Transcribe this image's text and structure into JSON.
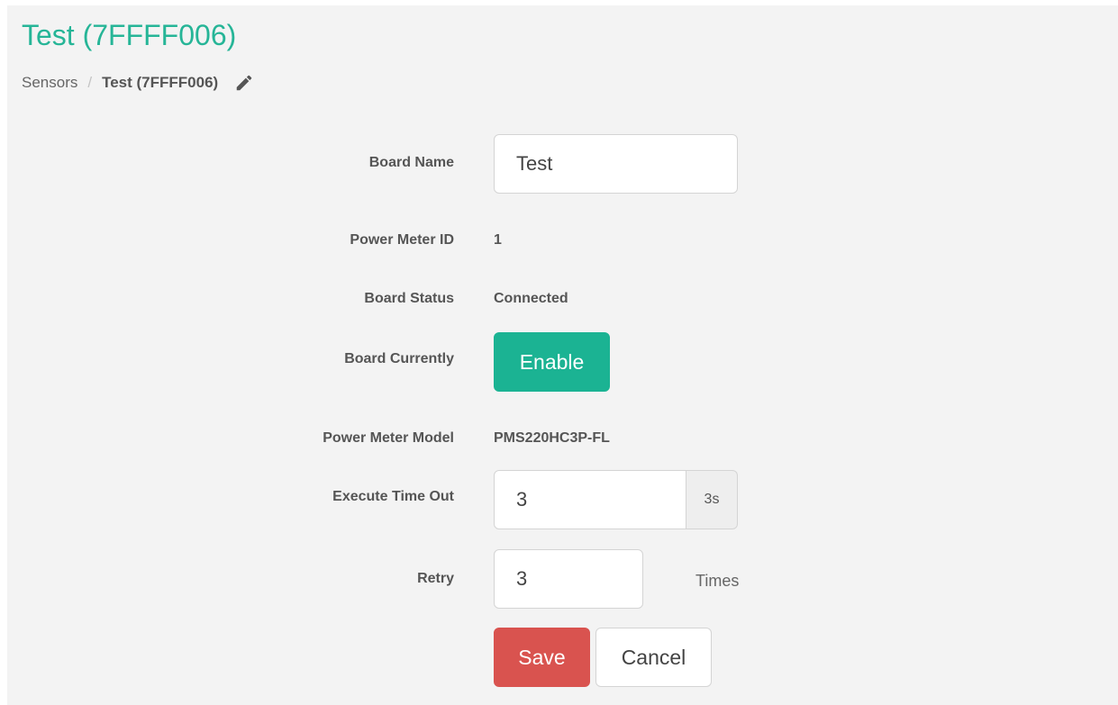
{
  "page": {
    "title": "Test (7FFFF006)"
  },
  "breadcrumb": {
    "parent": "Sensors",
    "separator": "/",
    "current": "Test (7FFFF006)",
    "edit_icon": "pencil-icon"
  },
  "form": {
    "board_name": {
      "label": "Board Name",
      "value": "Test"
    },
    "power_meter_id": {
      "label": "Power Meter ID",
      "value": "1"
    },
    "board_status": {
      "label": "Board Status",
      "value": "Connected"
    },
    "board_currently": {
      "label": "Board Currently",
      "button_label": "Enable"
    },
    "power_meter_model": {
      "label": "Power Meter Model",
      "value": "PMS220HC3P-FL"
    },
    "execute_time_out": {
      "label": "Execute Time Out",
      "value": "3",
      "addon": "3s"
    },
    "retry": {
      "label": "Retry",
      "value": "3",
      "unit": "Times"
    }
  },
  "actions": {
    "save_label": "Save",
    "cancel_label": "Cancel"
  },
  "colors": {
    "title": "#26b597",
    "enable_button": "#1bb393",
    "save_button": "#d9534f",
    "panel_background": "#f3f3f3"
  }
}
